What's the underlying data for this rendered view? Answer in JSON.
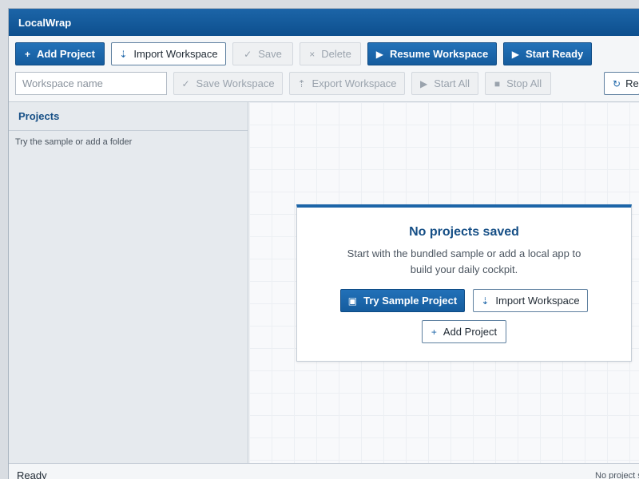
{
  "window": {
    "title": "LocalWrap"
  },
  "toolbar": {
    "add_project": "Add Project",
    "import_workspace": "Import Workspace",
    "save": "Save",
    "delete": "Delete",
    "resume_workspace": "Resume Workspace",
    "start_ready": "Start Ready",
    "workspace_name_placeholder": "Workspace name",
    "save_workspace": "Save Workspace",
    "export_workspace": "Export Workspace",
    "start_all": "Start All",
    "stop_all": "Stop All",
    "refresh": "Re"
  },
  "sidebar": {
    "title": "Projects",
    "hint": "Try the sample or add a folder"
  },
  "empty_state": {
    "title": "No projects saved",
    "description": "Start with the bundled sample or add a local app to build your daily cockpit.",
    "try_sample": "Try Sample Project",
    "import_workspace": "Import Workspace",
    "add_project": "Add Project"
  },
  "status": {
    "left": "Ready",
    "right": "No project s"
  },
  "icons": {
    "plus": "plus-icon",
    "import": "download-arrow-icon",
    "check": "check-icon",
    "close": "x-icon",
    "play": "play-icon",
    "export": "upload-arrow-icon",
    "stop": "stop-square-icon",
    "refresh": "refresh-icon",
    "sample": "square-icon"
  },
  "colors": {
    "primary": "#1c65a8",
    "title_text": "#164f86"
  }
}
